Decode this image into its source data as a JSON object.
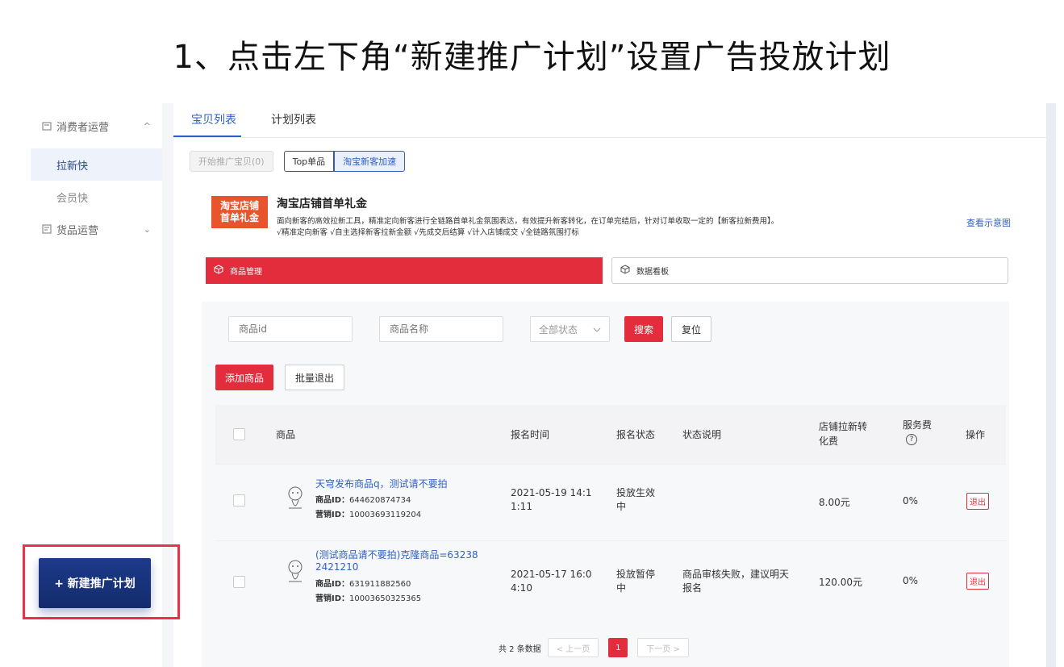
{
  "heading": "1、点击左下角“新建推广计划”设置广告投放计划",
  "sidebar": {
    "group1": {
      "label": "消费者运营",
      "chevron": "^"
    },
    "items": [
      {
        "label": "拉新快"
      },
      {
        "label": "会员快"
      }
    ],
    "group2": {
      "label": "货品运营",
      "chevron": "⌄"
    },
    "new_plan_label": "+ 新建推广计划"
  },
  "tabs": [
    {
      "label": "宝贝列表"
    },
    {
      "label": "计划列表"
    }
  ],
  "actions": {
    "start_promo": "开始推广宝贝(0)",
    "seg_top": "Top单品",
    "seg_taobao": "淘宝新客加速"
  },
  "promo": {
    "logo_line1": "淘宝店铺",
    "logo_line2": "首单礼金",
    "title": "淘宝店铺首单礼金",
    "desc": "面向新客的高效拉新工具，精准定向新客进行全链路首单礼金氛围表达，有效提升新客转化，在订单完结后，针对订单收取一定的【新客拉新费用】。",
    "tags": "√精准定向新客  √自主选择新客拉新金额  √先成交后结算  √计入店铺成交  √全链路氛围打标",
    "view_link": "查看示意图"
  },
  "section_tabs": {
    "goods": "商品管理",
    "dashboard": "数据看板"
  },
  "filters": {
    "id_placeholder": "商品id",
    "name_placeholder": "商品名称",
    "status": "全部状态",
    "search": "搜索",
    "reset": "复位"
  },
  "ops": {
    "add": "添加商品",
    "batch_exit": "批量退出"
  },
  "table": {
    "headers": {
      "product": "商品",
      "time": "报名时间",
      "status": "报名状态",
      "desc": "状态说明",
      "fee_line1": "店铺拉新转",
      "fee_line2": "化费",
      "service": "服务费",
      "service_q": "?",
      "ops": "操作"
    },
    "rows": [
      {
        "name": "天穹发布商品q，测试请不要拍",
        "name2": "",
        "id_label": "商品ID：",
        "id": "644620874734",
        "mkt_label": "营销ID：",
        "mkt_id": "10003693119204",
        "time1": "2021-05-19 14:1",
        "time2": "1:11",
        "status1": "投放生效",
        "status2": "中",
        "desc1": "",
        "desc2": "",
        "fee": "8.00元",
        "service": "0%",
        "op": "退出"
      },
      {
        "name": "(测试商品请不要拍)克隆商品=63238",
        "name2": "2421210",
        "id_label": "商品ID：",
        "id": "631911882560",
        "mkt_label": "营销ID：",
        "mkt_id": "10003650325365",
        "time1": "2021-05-17 16:0",
        "time2": "4:10",
        "status1": "投放暂停",
        "status2": "中",
        "desc1": "商品审核失败，建议明天",
        "desc2": "报名",
        "fee": "120.00元",
        "service": "0%",
        "op": "退出"
      }
    ]
  },
  "pager": {
    "total": "共 2 条数据",
    "prev": "< 上一页",
    "current": "1",
    "next": "下一页 >"
  },
  "colors": {
    "accent_red": "#e32d3d",
    "link_blue": "#2f5fc4",
    "nav_dark": "#1d3a8a",
    "highlight_frame": "#e8324a"
  }
}
